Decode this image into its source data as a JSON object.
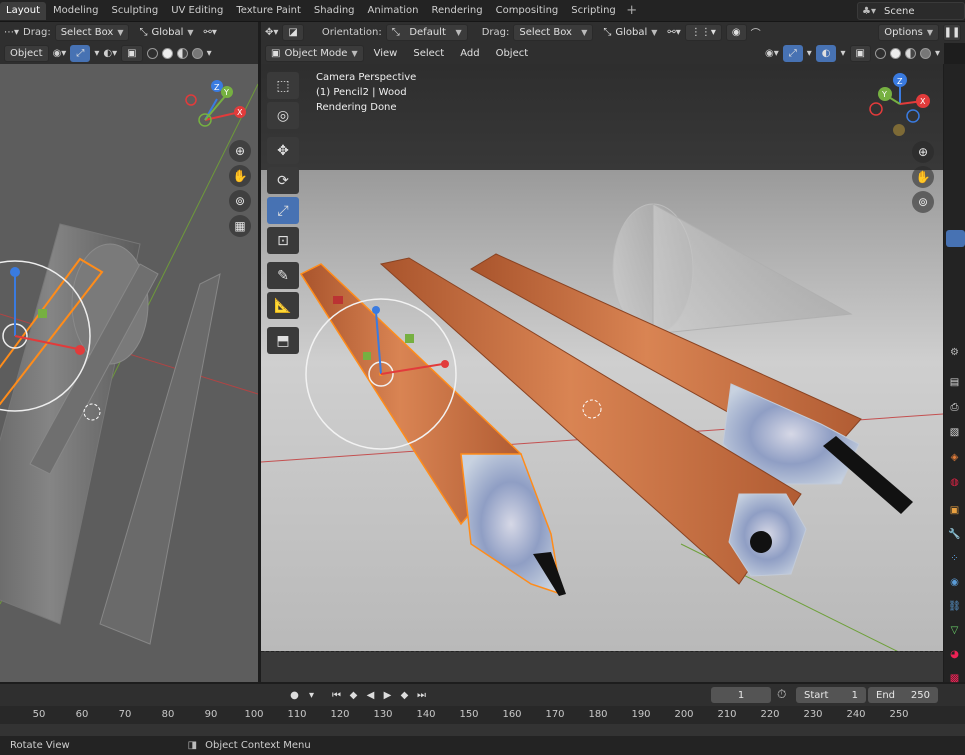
{
  "workspace_tabs": [
    "Layout",
    "Modeling",
    "Sculpting",
    "UV Editing",
    "Texture Paint",
    "Shading",
    "Animation",
    "Rendering",
    "Compositing",
    "Scripting"
  ],
  "active_tab": "Layout",
  "add_tab_label": "+",
  "scene": {
    "label": "Scene"
  },
  "left_header": {
    "object_label": "Object",
    "drag_label": "Drag:",
    "drag_value": "Select Box",
    "transform_value": "Global"
  },
  "main_header": {
    "drag_label": "Drag:",
    "drag_value": "Select Box",
    "orientation_label": "Orientation:",
    "orientation_value": "Default",
    "transform_value": "Global",
    "options_label": "Options",
    "mode_value": "Object Mode",
    "menus": [
      "View",
      "Select",
      "Add",
      "Object"
    ]
  },
  "viewport_overlay": {
    "line1": "Camera Perspective",
    "line2": "(1) Pencil2 | Wood",
    "line3": "Rendering Done"
  },
  "gizmo_axes": {
    "x": "X",
    "y": "Y",
    "z": "Z"
  },
  "toolbar_tools": [
    "cursor-select",
    "3d-cursor",
    "move",
    "rotate",
    "scale",
    "transform",
    "annotate",
    "measure",
    "add-cube"
  ],
  "active_tool": "scale",
  "timeline": {
    "current_frame": "1",
    "start_label": "Start",
    "start_value": "1",
    "end_label": "End",
    "end_value": "250",
    "ruler_ticks": [
      "50",
      "60",
      "70",
      "80",
      "90",
      "100",
      "110",
      "120",
      "130",
      "140",
      "150",
      "160",
      "170",
      "180",
      "190",
      "200",
      "210",
      "220",
      "230",
      "240",
      "250"
    ]
  },
  "status": {
    "left": "Rotate View",
    "middle": "Object Context Menu"
  },
  "colors": {
    "accent": "#4772b3",
    "pencil_orange": "#c6693a",
    "selection_orange": "#ff8c1a",
    "axis_red": "#e23b3b",
    "axis_green": "#76b041",
    "axis_blue": "#3a7be0"
  }
}
